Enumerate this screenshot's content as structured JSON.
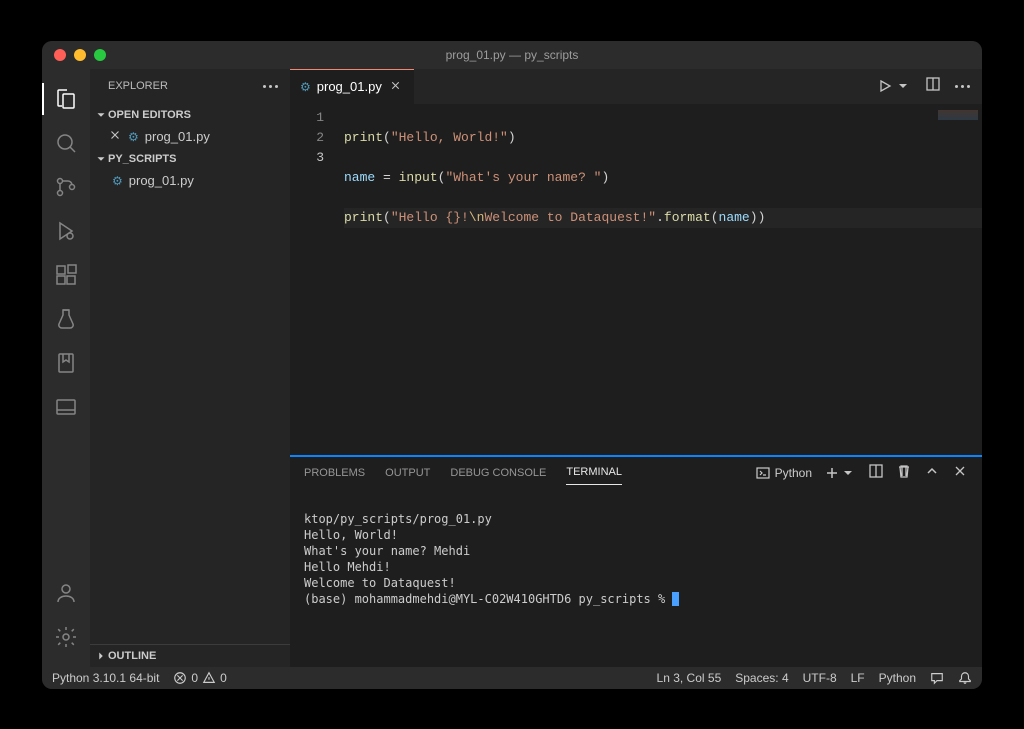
{
  "window": {
    "title": "prog_01.py — py_scripts"
  },
  "sidebar": {
    "title": "EXPLORER",
    "open_editors_label": "OPEN EDITORS",
    "folder_label": "PY_SCRIPTS",
    "outline_label": "OUTLINE",
    "open_editors": [
      {
        "name": "prog_01.py"
      }
    ],
    "files": [
      {
        "name": "prog_01.py"
      }
    ]
  },
  "editor": {
    "tab_label": "prog_01.py",
    "lines": {
      "l1": {
        "num": "1"
      },
      "l2": {
        "num": "2"
      },
      "l3": {
        "num": "3"
      }
    },
    "code": {
      "print1": "print",
      "paren_o": "(",
      "str1": "\"Hello, World!\"",
      "paren_c": ")",
      "name_var": "name",
      "eq": " = ",
      "input_fn": "input",
      "str2": "\"What's your name? \"",
      "print2": "print",
      "str3a": "\"Hello {}!",
      "esc1": "\\n",
      "str3b": "Welcome to Dataquest!\"",
      "dot": ".",
      "format_fn": "format",
      "name_arg": "name"
    }
  },
  "panel": {
    "tabs": {
      "problems": "PROBLEMS",
      "output": "OUTPUT",
      "debug": "DEBUG CONSOLE",
      "terminal": "TERMINAL"
    },
    "terminal_kind": "Python",
    "terminal_lines": [
      "ktop/py_scripts/prog_01.py",
      "Hello, World!",
      "What's your name? Mehdi",
      "Hello Mehdi!",
      "Welcome to Dataquest!",
      "(base) mohammadmehdi@MYL-C02W410GHTD6 py_scripts % "
    ]
  },
  "status": {
    "python_version": "Python 3.10.1 64-bit",
    "errors": "0",
    "warnings": "0",
    "cursor_pos": "Ln 3, Col 55",
    "spaces": "Spaces: 4",
    "encoding": "UTF-8",
    "eol": "LF",
    "lang": "Python"
  }
}
